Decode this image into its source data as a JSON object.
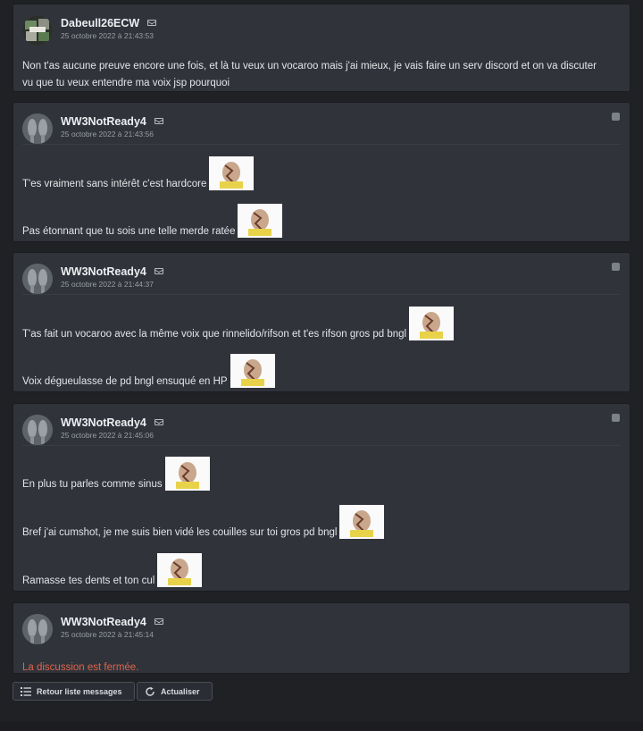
{
  "messages": [
    {
      "author": "Dabeull26ECW",
      "date": "25 octobre 2022 à 21:43:53",
      "lines": [
        "Non t'as aucune preuve encore une fois, et là tu veux un vocaroo mais j'ai mieux, je vais faire un serv discord et on va discuter",
        "vu que tu veux entendre ma voix jsp pourquoi"
      ]
    },
    {
      "author": "WW3NotReady4",
      "date": "25 octobre 2022 à 21:43:56",
      "lines": [
        "T'es vraiment sans intérêt c'est hardcore",
        "Pas étonnant que tu sois une telle merde ratée"
      ]
    },
    {
      "author": "WW3NotReady4",
      "date": "25 octobre 2022 à 21:44:37",
      "lines": [
        "T'as fait un vocaroo avec la même voix que rinnelido/rifson et t'es rifson gros pd bngl",
        "Voix dégueulasse de pd bngl ensuqué en HP"
      ]
    },
    {
      "author": "WW3NotReady4",
      "date": "25 octobre 2022 à 21:45:06",
      "lines": [
        "En plus tu parles comme sinus",
        "Bref j'ai cumshot, je me suis bien vidé les couilles sur toi gros pd bngl",
        "Ramasse tes dents et ton cul"
      ]
    },
    {
      "author": "WW3NotReady4",
      "date": "25 octobre 2022 à 21:45:14",
      "closed_notice": "La discussion est fermée."
    }
  ],
  "buttons": {
    "back_label": "Retour liste messages",
    "refresh_label": "Actualiser"
  },
  "icons": {
    "mail": "envelope-icon",
    "report": "report-icon",
    "back": "list-icon",
    "refresh": "refresh-icon"
  },
  "colors": {
    "background": "#1f2125",
    "card": "#30333a",
    "closed_text": "#e0644a"
  }
}
